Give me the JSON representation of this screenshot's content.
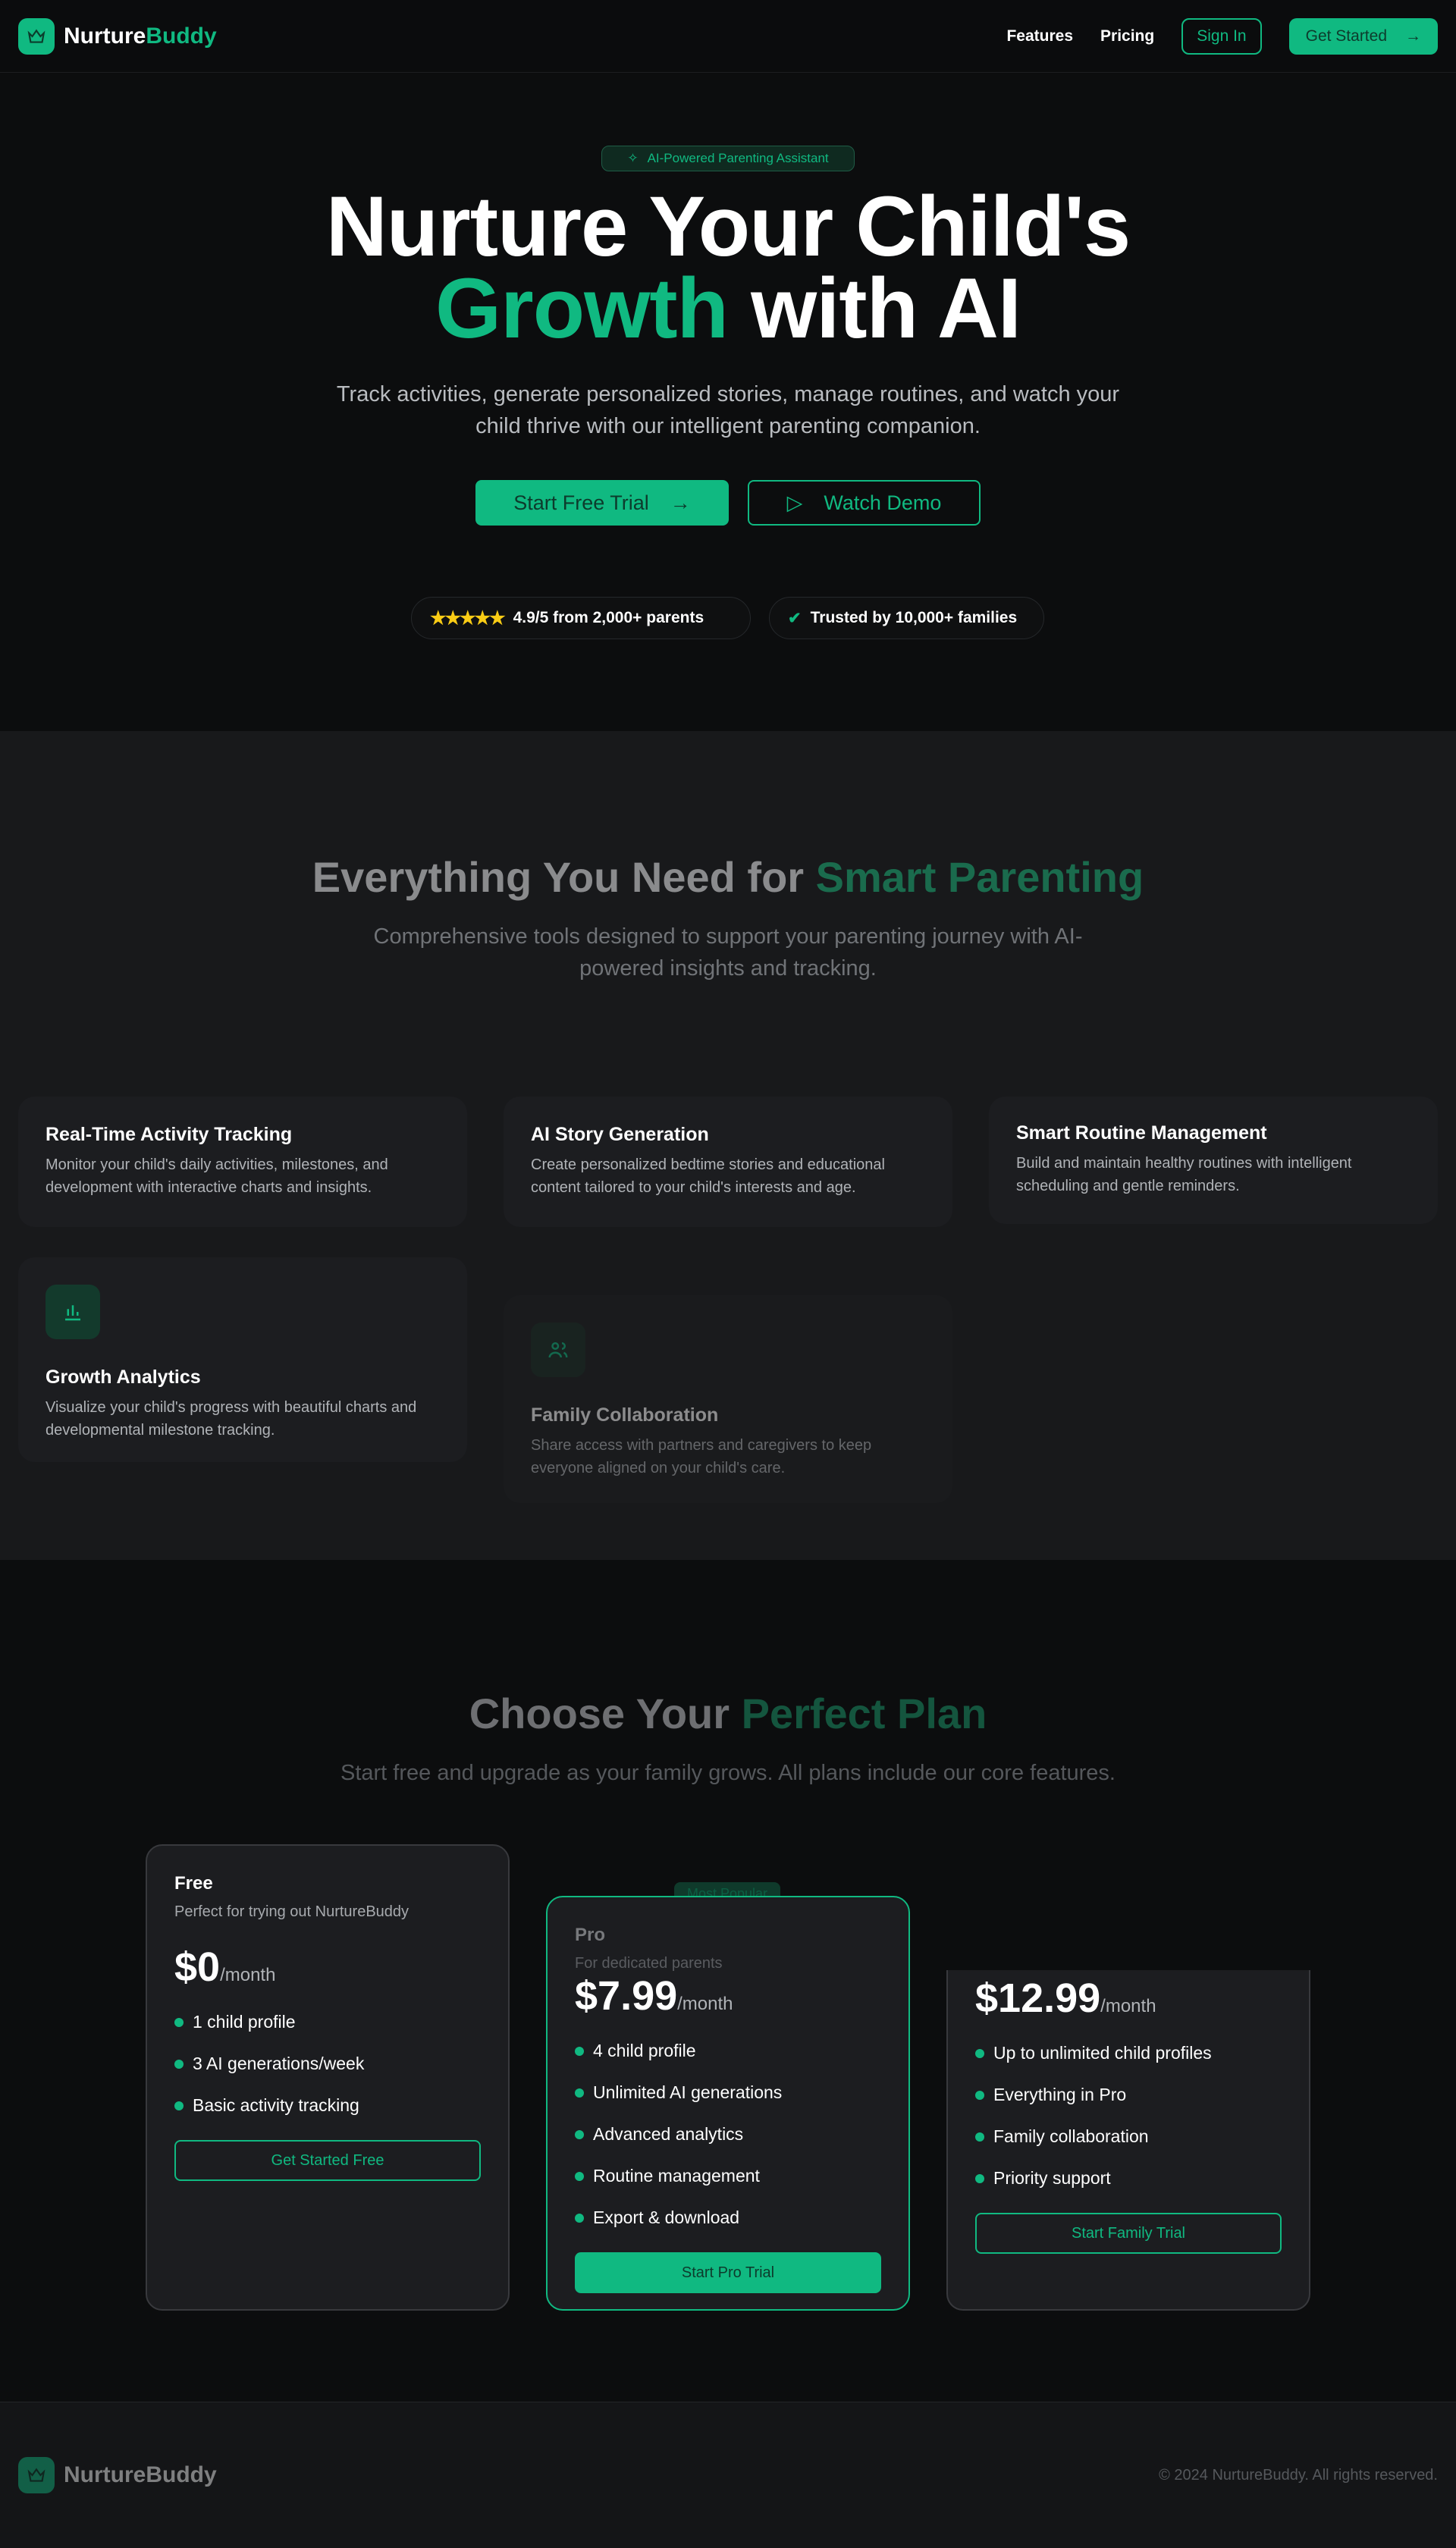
{
  "nav": {
    "brand_a": "Nurture",
    "brand_b": "Buddy",
    "features": "Features",
    "pricing": "Pricing",
    "sign_in": "Sign In",
    "get_started": "Get Started"
  },
  "hero": {
    "badge": "AI-Powered Parenting Assistant",
    "title_line1": "Nurture Your Child's",
    "title_green": "Growth",
    "title_rest": " with AI",
    "subtitle": "Track activities, generate personalized stories, manage routines, and watch your child thrive with our intelligent parenting companion.",
    "cta": "Start Free Trial",
    "demo": "Watch Demo",
    "rating": "4.9/5 from 2,000+ parents",
    "trusted": "Trusted by 10,000+ families"
  },
  "features": {
    "title_a": "Everything You Need for ",
    "title_b": "Smart Parenting",
    "subtitle": "Comprehensive tools designed to support your parenting journey with AI-powered insights and tracking.",
    "cards": [
      {
        "title": "Real-Time Activity Tracking",
        "desc": "Monitor your child's daily activities, milestones, and development with interactive charts and insights."
      },
      {
        "title": "AI Story Generation",
        "desc": "Create personalized bedtime stories and educational content tailored to your child's interests and age."
      },
      {
        "title": "Smart Routine Management",
        "desc": "Build and maintain healthy routines with intelligent scheduling and gentle reminders."
      },
      {
        "title": "Growth Analytics",
        "desc": "Visualize your child's progress with beautiful charts and developmental milestone tracking."
      },
      {
        "title": "Family Collaboration",
        "desc": "Share access with partners and caregivers to keep everyone aligned on your child's care."
      }
    ]
  },
  "pricing": {
    "title_a": "Choose Your ",
    "title_b": "Perfect Plan",
    "subtitle": "Start free and upgrade as your family grows. All plans include our core features.",
    "popular": "Most Popular",
    "per": "/month",
    "plans": [
      {
        "name": "Free",
        "desc": "Perfect for trying out NurtureBuddy",
        "price": "$0",
        "features": [
          "1 child profile",
          "3 AI generations/week",
          "Basic activity tracking"
        ],
        "button": "Get Started Free"
      },
      {
        "name": "Pro",
        "desc": "For dedicated parents",
        "price": "$7.99",
        "features": [
          "4 child profile",
          "Unlimited AI generations",
          "Advanced analytics",
          "Routine management",
          "Export & download"
        ],
        "button": "Start Pro Trial"
      },
      {
        "name": "",
        "desc": "",
        "price": "$12.99",
        "features": [
          "Up to unlimited child profiles",
          "Everything in Pro",
          "Family collaboration",
          "Priority support"
        ],
        "button": "Start Family Trial"
      }
    ]
  },
  "footer": {
    "brand": "NurtureBuddy",
    "copyright": "© 2024 NurtureBuddy. All rights reserved."
  },
  "colors": {
    "accent": "#10b981",
    "star": "#facc15",
    "background": "#0b0c0d"
  }
}
